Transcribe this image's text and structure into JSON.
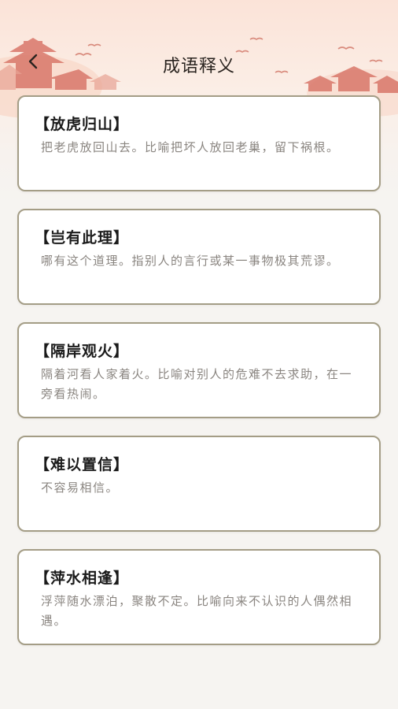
{
  "nav": {
    "title": "成语释义",
    "back_icon": "chevron-left-icon"
  },
  "idioms": [
    {
      "title": "【放虎归山】",
      "desc": "把老虎放回山去。比喻把坏人放回老巢，留下祸根。"
    },
    {
      "title": "【岂有此理】",
      "desc": "哪有这个道理。指别人的言行或某一事物极其荒谬。"
    },
    {
      "title": "【隔岸观火】",
      "desc": "隔着河看人家着火。比喻对别人的危难不去求助，在一旁看热闹。"
    },
    {
      "title": "【难以置信】",
      "desc": "不容易相信。"
    },
    {
      "title": "【萍水相逢】",
      "desc": "浮萍随水漂泊，聚散不定。比喻向来不认识的人偶然相遇。"
    }
  ],
  "colors": {
    "card_border": "#a49d86",
    "background": "#f6f4f1",
    "header_tint": "#fbe3d8",
    "title_text": "#1b1b1b",
    "desc_text": "#8a8580"
  }
}
